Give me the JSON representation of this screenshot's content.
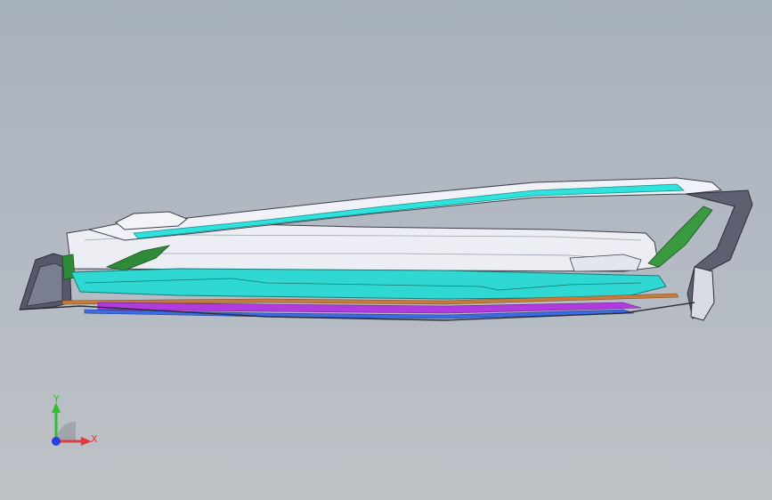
{
  "viewport": {
    "background_top": "#a7b0bd",
    "background_bottom": "#bfc2c6"
  },
  "model": {
    "part_colors": {
      "shell": "#e9eaf0",
      "shell_edge": "#3d3f4a",
      "cyan_trim": "#2ee3dd",
      "teal_panel": "#1fb7b5",
      "green_bracket": "#2f8a3a",
      "magenta_strip": "#b23be0",
      "blue_strip": "#3c6be6",
      "copper": "#c77a3a",
      "dark_frame": "#3a3e49"
    }
  },
  "triad": {
    "x_label": "X",
    "y_label": "Y",
    "x_color": "#e23b3b",
    "y_color": "#2fbf2f",
    "z_color": "#2a3fe0"
  }
}
